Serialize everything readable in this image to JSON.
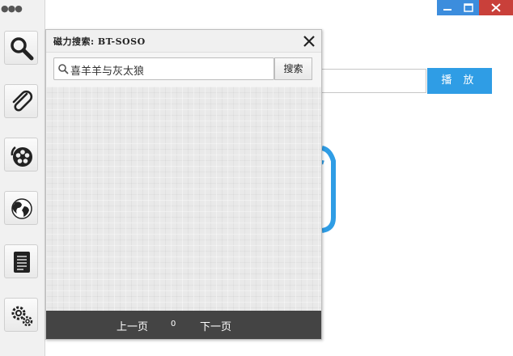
{
  "sidebar": {
    "menu_dots": "●●●",
    "items": [
      {
        "icon": "search-icon"
      },
      {
        "icon": "paperclip-icon"
      },
      {
        "icon": "film-reel-icon"
      },
      {
        "icon": "globe-icon"
      },
      {
        "icon": "document-icon"
      },
      {
        "icon": "gears-icon"
      }
    ]
  },
  "main": {
    "url_value": "",
    "play_label": "播 放"
  },
  "dialog": {
    "title": "磁力搜索: BT-SOSO",
    "search_value": "喜羊羊与灰太狼",
    "search_button_label": "搜索",
    "pager": {
      "prev_label": "上一页",
      "page_number": "0",
      "next_label": "下一页"
    }
  },
  "colors": {
    "accent": "#2f9de5",
    "pager_bg": "#444444",
    "close_red": "#c9403a"
  }
}
